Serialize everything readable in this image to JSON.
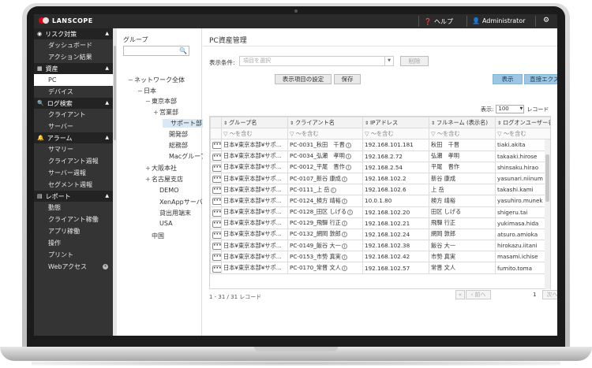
{
  "topbar": {
    "logo": "LANSCOPE",
    "help": "ヘルプ",
    "user": "Administrator"
  },
  "nav": {
    "sections": [
      {
        "title": "リスク対策",
        "items": [
          "ダッシュボード",
          "アクション結果"
        ]
      },
      {
        "title": "資産",
        "items": [
          "PC",
          "デバイス"
        ]
      },
      {
        "title": "ログ検索",
        "items": [
          "クライアント",
          "サーバー"
        ]
      },
      {
        "title": "アラーム",
        "items": [
          "サマリー",
          "クライアント週報",
          "サーバー週報",
          "セグメント週報"
        ]
      },
      {
        "title": "レポート",
        "items": [
          "動態",
          "クライアント稼働",
          "アプリ稼働",
          "操作",
          "プリント",
          "Webアクセス"
        ]
      }
    ],
    "active_item": "PC"
  },
  "tree": {
    "title": "グループ",
    "nodes": [
      {
        "label": "ネットワーク全体",
        "toggle": "−"
      },
      {
        "label": "日本",
        "toggle": "−"
      },
      {
        "label": "東京本部",
        "toggle": "−"
      },
      {
        "label": "営業部",
        "toggle": "+"
      },
      {
        "label": "サポート部",
        "toggle": ""
      },
      {
        "label": "開発部",
        "toggle": ""
      },
      {
        "label": "総務部",
        "toggle": ""
      },
      {
        "label": "Macグループ",
        "toggle": ""
      },
      {
        "label": "大阪本社",
        "toggle": "+"
      },
      {
        "label": "名古屋支店",
        "toggle": "+"
      },
      {
        "label": "DEMO",
        "toggle": ""
      },
      {
        "label": "XenAppサーバ",
        "toggle": ""
      },
      {
        "label": "貸出用端末",
        "toggle": ""
      },
      {
        "label": "USA",
        "toggle": ""
      },
      {
        "label": "中国",
        "toggle": ""
      }
    ]
  },
  "main": {
    "title": "PC資産管理",
    "condition_label": "表示条件:",
    "condition_placeholder": "項目を選択",
    "clear_button": "削除",
    "display_settings_button": "表示項目の設定",
    "save_button": "保存",
    "display_button": "表示",
    "export_button": "直接エクスポート",
    "per_page_label": "表示:",
    "per_page_value": "100",
    "per_page_unit": "レコード",
    "record_count": "1 - 31 / 31 レコード",
    "pager": {
      "prev": "前へ",
      "page": "1",
      "next": "次へ"
    }
  },
  "table": {
    "headers": [
      "",
      "グループ名",
      "クライアント名",
      "IPアドレス",
      "フルネーム (表示名)",
      "ログオンユーザー名"
    ],
    "filter_text": "〜を含む",
    "rows": [
      [
        "日本¥東京本部¥サポ…",
        "PC-0031_秋田　千晋",
        "192.168.101.181",
        "秋田　千晋",
        "tiaki.akita"
      ],
      [
        "日本¥東京本部¥サポ…",
        "PC-0034_弘瀬　孝明",
        "192.168.2.72",
        "弘瀬　孝明",
        "takaaki.hirose"
      ],
      [
        "日本¥東京本部¥サポ…",
        "PC-0012_平尾　晋作",
        "192.168.2.54",
        "平尾　晋作",
        "shinsaku.hirao"
      ],
      [
        "日本¥東京本部¥サポ…",
        "PC-0107_新谷 康成",
        "192.168.102.2",
        "新谷 康成",
        "yasunari.niinum"
      ],
      [
        "日本¥東京本部¥サポ…",
        "PC-0111_上 岳",
        "192.168.102.6",
        "上 岳",
        "takashi.kami"
      ],
      [
        "日本¥東京本部¥サポ…",
        "PC-0124_検方 靖裕",
        "10.0.1.80",
        "検方 靖裕",
        "yasuhiro.munek"
      ],
      [
        "日本¥東京本部¥サポ…",
        "PC-0128_田区 しげる",
        "192.168.102.20",
        "田区 しげる",
        "shigeru.tai"
      ],
      [
        "日本¥東京本部¥サポ…",
        "PC-0129_飛驒 行正",
        "192.168.102.21",
        "飛驒 行正",
        "yukimasa.hida"
      ],
      [
        "日本¥東京本部¥サポ…",
        "PC-0132_網岡 敦郎",
        "192.168.102.24",
        "網岡 敦郎",
        "atsuro.amioka"
      ],
      [
        "日本¥東京本部¥サポ…",
        "PC-0149_飯谷 大一",
        "192.168.102.38",
        "飯谷 大一",
        "hirokazu.iitani"
      ],
      [
        "日本¥東京本部¥サポ…",
        "PC-0153_市勢 真実",
        "192.168.102.42",
        "市勢 真実",
        "masami.ichise"
      ],
      [
        "日本¥東京本部¥サポ…",
        "PC-0170_常晋 文人",
        "192.168.102.57",
        "常晋 文人",
        "fumito.toma"
      ]
    ]
  }
}
